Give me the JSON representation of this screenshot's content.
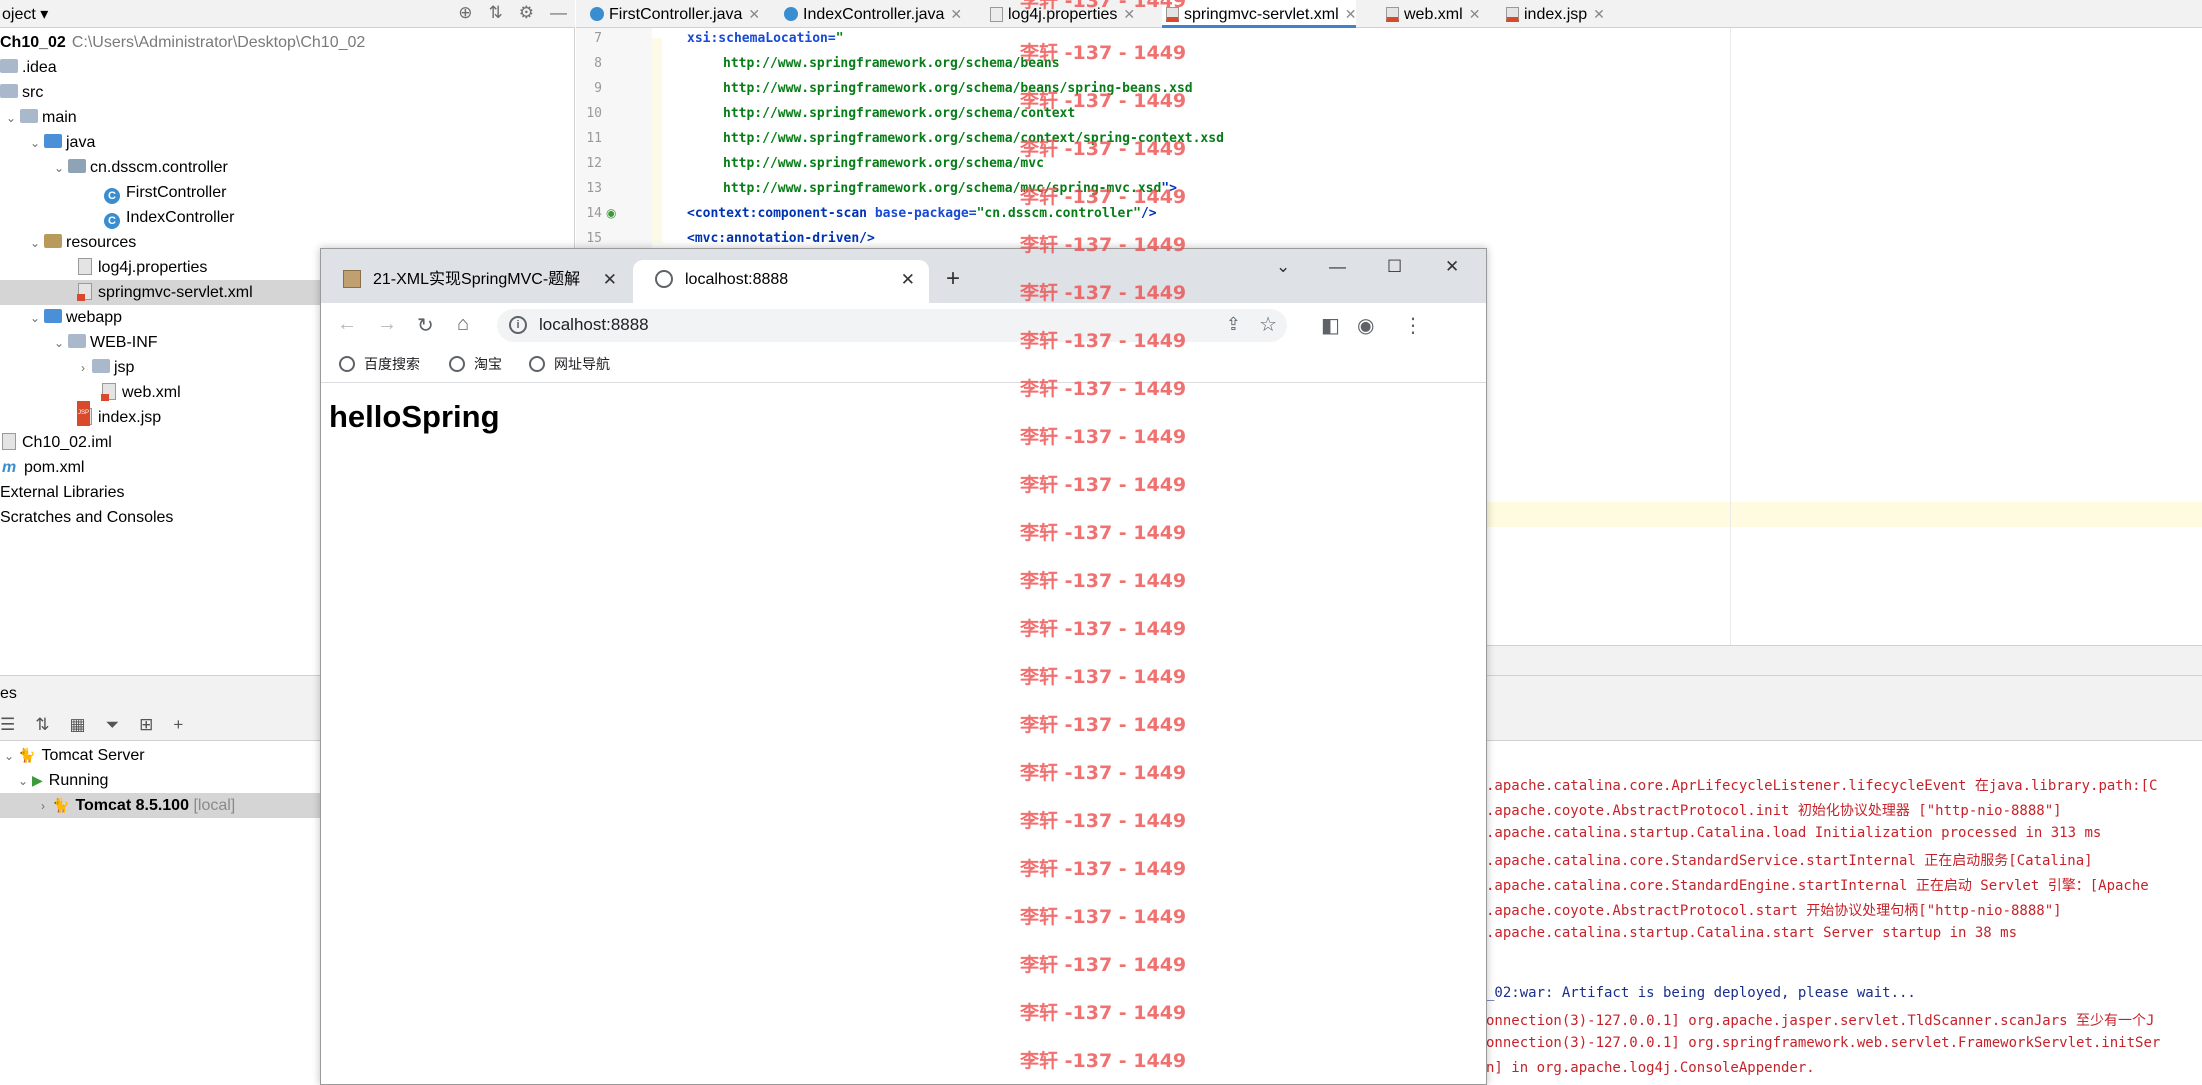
{
  "project_panel": {
    "title": "oject",
    "tree": [
      {
        "label": "Ch10_02",
        "path": "C:\\Users\\Administrator\\Desktop\\Ch10_02"
      },
      {
        "label": ".idea"
      },
      {
        "label": "src"
      },
      {
        "label": "main"
      },
      {
        "label": "java"
      },
      {
        "label": "cn.dsscm.controller"
      },
      {
        "label": "FirstController"
      },
      {
        "label": "IndexController"
      },
      {
        "label": "resources"
      },
      {
        "label": "log4j.properties"
      },
      {
        "label": "springmvc-servlet.xml"
      },
      {
        "label": "webapp"
      },
      {
        "label": "WEB-INF"
      },
      {
        "label": "jsp"
      },
      {
        "label": "web.xml"
      },
      {
        "label": "index.jsp"
      },
      {
        "label": "Ch10_02.iml"
      },
      {
        "label": "pom.xml"
      },
      {
        "label": "External Libraries"
      },
      {
        "label": "Scratches and Consoles"
      }
    ]
  },
  "editor": {
    "tabs": [
      {
        "label": "FirstController.java"
      },
      {
        "label": "IndexController.java"
      },
      {
        "label": "log4j.properties"
      },
      {
        "label": "springmvc-servlet.xml"
      },
      {
        "label": "web.xml"
      },
      {
        "label": "index.jsp"
      }
    ],
    "line_numbers": [
      "7",
      "8",
      "9",
      "10",
      "11",
      "12",
      "13",
      "14",
      "15"
    ],
    "lines": {
      "l7_attr": "xsi:schemaLocation=",
      "l7_str": "\"",
      "l8": "http://www.springframework.org/schema/beans",
      "l9": "http://www.springframework.org/schema/beans/spring-beans.xsd",
      "l10": "http://www.springframework.org/schema/context",
      "l11": "http://www.springframework.org/schema/context/spring-context.xsd",
      "l12": "http://www.springframework.org/schema/mvc",
      "l13": "http://www.springframework.org/schema/mvc/spring-mvc.xsd",
      "l13_end": "\">",
      "l14_open": "<context:component-scan ",
      "l14_attr": "base-package=",
      "l14_val": "\"cn.dsscm.controller\"",
      "l14_close": "/>",
      "l15": "<mvc:annotation-driven/>"
    }
  },
  "services": {
    "title": "es",
    "tree": [
      {
        "label": "Tomcat Server"
      },
      {
        "label": "Running"
      },
      {
        "label": "Tomcat 8.5.100",
        "suffix": "[local]"
      }
    ]
  },
  "console": {
    "lines": [
      ".apache.catalina.core.AprLifecycleListener.lifecycleEvent 在java.library.path:[C",
      ".apache.coyote.AbstractProtocol.init 初始化协议处理器 [\"http-nio-8888\"]",
      ".apache.catalina.startup.Catalina.load Initialization processed in 313 ms",
      ".apache.catalina.core.StandardService.startInternal 正在启动服务[Catalina]",
      ".apache.catalina.core.StandardEngine.startInternal 正在启动 Servlet 引擎：[Apache",
      ".apache.coyote.AbstractProtocol.start 开始协议处理句柄[\"http-nio-8888\"]",
      ".apache.catalina.startup.Catalina.start Server startup in 38 ms",
      "_02:war: Artifact is being deployed, please wait...",
      "onnection(3)-127.0.0.1] org.apache.jasper.servlet.TldScanner.scanJars 至少有一个J",
      "onnection(3)-127.0.0.1] org.springframework.web.servlet.FrameworkServlet.initSer",
      "n] in org.apache.log4j.ConsoleAppender."
    ]
  },
  "browser": {
    "tabs": [
      {
        "label": "21-XML实现SpringMVC-题解"
      },
      {
        "label": "localhost:8888"
      }
    ],
    "url": "localhost:8888",
    "bookmarks": [
      {
        "label": "百度搜索"
      },
      {
        "label": "淘宝"
      },
      {
        "label": "网址导航"
      }
    ],
    "content": {
      "heading": "helloSpring"
    }
  },
  "watermark": {
    "text": "李轩 -137 - 1449"
  },
  "icons": {
    "java_class": "c-circle-icon",
    "folder": "folder-icon",
    "maven": "maven-m-icon"
  },
  "colors": {
    "selection": "#d5d5d5",
    "xml_attr": "#174ad4",
    "xml_string": "#067d17",
    "log_red": "#c7222a",
    "watermark": "#ee5050"
  }
}
